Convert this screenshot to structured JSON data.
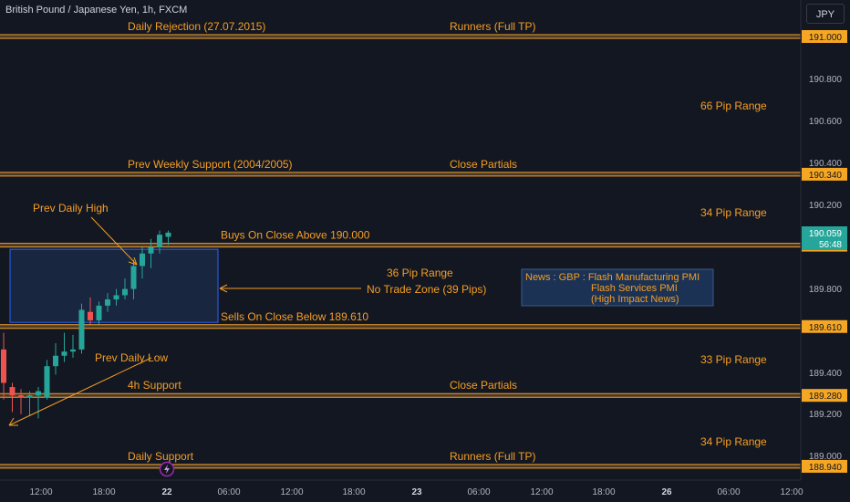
{
  "header": {
    "symbol_title": "British Pound / Japanese Yen, 1h, FXCM",
    "currency_button": "JPY"
  },
  "price_axis": {
    "ticks": [
      "190.800",
      "190.600",
      "190.400",
      "190.200",
      "189.800",
      "189.400",
      "189.200",
      "189.000"
    ],
    "level_badges": [
      "191.000",
      "190.340",
      "190.000",
      "189.610",
      "189.280",
      "188.940"
    ],
    "last_price": "190.059",
    "countdown": "56:48"
  },
  "time_axis": {
    "ticks": [
      "12:00",
      "18:00",
      "22",
      "06:00",
      "12:00",
      "18:00",
      "23",
      "06:00",
      "12:00",
      "18:00",
      "26",
      "06:00",
      "12:00"
    ]
  },
  "levels": [
    {
      "price": 191.0,
      "left_label": "Daily Rejection (27.07.2015)",
      "right_label": "Runners (Full TP)"
    },
    {
      "price": 190.34,
      "left_label": "Prev Weekly Support (2004/2005)",
      "right_label": "Close Partials"
    },
    {
      "price": 190.0,
      "left_label": "Buys On Close Above 190.000",
      "right_label": ""
    },
    {
      "price": 189.61,
      "left_label": "Sells On Close Below 189.610",
      "right_label": ""
    },
    {
      "price": 189.28,
      "left_label": "4h Support",
      "right_label": "Close Partials"
    },
    {
      "price": 188.94,
      "left_label": "Daily Support",
      "right_label": "Runners (Full TP)"
    }
  ],
  "range_labels": [
    "66 Pip Range",
    "34 Pip Range",
    "33 Pip Range",
    "34 Pip Range"
  ],
  "zone": {
    "range_label": "36 Pip Range",
    "zone_label": "No Trade Zone (39 Pips)"
  },
  "annotations": {
    "prev_daily_high": "Prev Daily High",
    "prev_daily_low": "Prev Daily Low"
  },
  "news": {
    "line1": "News : GBP : Flash Manufacturing PMI",
    "line2": "Flash Services PMI",
    "line3": "(High Impact News)"
  },
  "colors": {
    "background": "#131722",
    "level_line": "#f0a030",
    "label_text": "#f59e23",
    "bull": "#26a69a",
    "bear": "#ef5350",
    "zone_fill": "#1e3a63",
    "zone_border": "#2962ff",
    "axis_text": "#b2b5be",
    "badge_bg": "#f5a623",
    "last_price_bg": "#26a69a"
  },
  "chart_data": {
    "type": "candlestick",
    "candles": [
      {
        "o": 189.5,
        "h": 189.58,
        "l": 189.26,
        "c": 189.34
      },
      {
        "o": 189.32,
        "h": 189.34,
        "l": 189.2,
        "c": 189.28
      },
      {
        "o": 189.28,
        "h": 189.31,
        "l": 189.19,
        "c": 189.27
      },
      {
        "o": 189.27,
        "h": 189.3,
        "l": 189.18,
        "c": 189.28
      },
      {
        "o": 189.28,
        "h": 189.32,
        "l": 189.17,
        "c": 189.3
      },
      {
        "o": 189.27,
        "h": 189.45,
        "l": 189.26,
        "c": 189.42
      },
      {
        "o": 189.42,
        "h": 189.53,
        "l": 189.38,
        "c": 189.47
      },
      {
        "o": 189.47,
        "h": 189.58,
        "l": 189.44,
        "c": 189.49
      },
      {
        "o": 189.49,
        "h": 189.57,
        "l": 189.46,
        "c": 189.5
      },
      {
        "o": 189.5,
        "h": 189.72,
        "l": 189.48,
        "c": 189.69
      },
      {
        "o": 189.68,
        "h": 189.75,
        "l": 189.62,
        "c": 189.64
      },
      {
        "o": 189.64,
        "h": 189.73,
        "l": 189.62,
        "c": 189.71
      },
      {
        "o": 189.71,
        "h": 189.77,
        "l": 189.68,
        "c": 189.74
      },
      {
        "o": 189.74,
        "h": 189.79,
        "l": 189.71,
        "c": 189.76
      },
      {
        "o": 189.76,
        "h": 189.84,
        "l": 189.74,
        "c": 189.79
      },
      {
        "o": 189.79,
        "h": 189.93,
        "l": 189.74,
        "c": 189.9
      },
      {
        "o": 189.9,
        "h": 189.99,
        "l": 189.84,
        "c": 189.96
      },
      {
        "o": 189.96,
        "h": 190.03,
        "l": 189.89,
        "c": 189.99
      },
      {
        "o": 189.99,
        "h": 190.07,
        "l": 189.96,
        "c": 190.05
      },
      {
        "o": 190.04,
        "h": 190.07,
        "l": 190.0,
        "c": 190.06
      }
    ],
    "y_range": [
      188.92,
      191.02
    ]
  }
}
